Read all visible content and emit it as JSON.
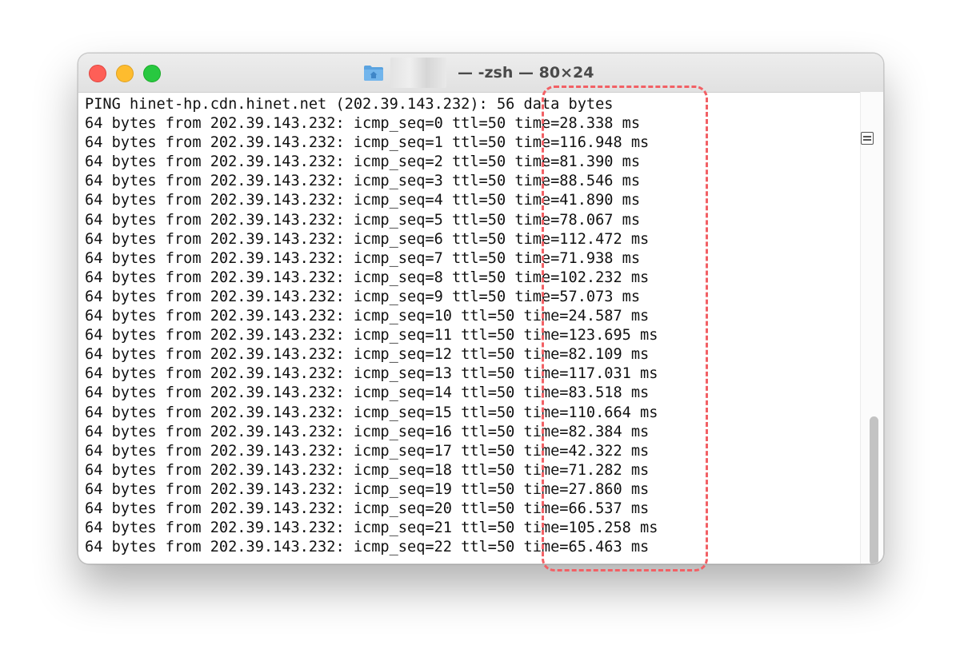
{
  "window": {
    "title": "— -zsh — 80×24",
    "folder_icon": "home-folder-icon"
  },
  "terminal": {
    "lines": [
      "PING hinet-hp.cdn.hinet.net (202.39.143.232): 56 data bytes",
      "64 bytes from 202.39.143.232: icmp_seq=0 ttl=50 time=28.338 ms",
      "64 bytes from 202.39.143.232: icmp_seq=1 ttl=50 time=116.948 ms",
      "64 bytes from 202.39.143.232: icmp_seq=2 ttl=50 time=81.390 ms",
      "64 bytes from 202.39.143.232: icmp_seq=3 ttl=50 time=88.546 ms",
      "64 bytes from 202.39.143.232: icmp_seq=4 ttl=50 time=41.890 ms",
      "64 bytes from 202.39.143.232: icmp_seq=5 ttl=50 time=78.067 ms",
      "64 bytes from 202.39.143.232: icmp_seq=6 ttl=50 time=112.472 ms",
      "64 bytes from 202.39.143.232: icmp_seq=7 ttl=50 time=71.938 ms",
      "64 bytes from 202.39.143.232: icmp_seq=8 ttl=50 time=102.232 ms",
      "64 bytes from 202.39.143.232: icmp_seq=9 ttl=50 time=57.073 ms",
      "64 bytes from 202.39.143.232: icmp_seq=10 ttl=50 time=24.587 ms",
      "64 bytes from 202.39.143.232: icmp_seq=11 ttl=50 time=123.695 ms",
      "64 bytes from 202.39.143.232: icmp_seq=12 ttl=50 time=82.109 ms",
      "64 bytes from 202.39.143.232: icmp_seq=13 ttl=50 time=117.031 ms",
      "64 bytes from 202.39.143.232: icmp_seq=14 ttl=50 time=83.518 ms",
      "64 bytes from 202.39.143.232: icmp_seq=15 ttl=50 time=110.664 ms",
      "64 bytes from 202.39.143.232: icmp_seq=16 ttl=50 time=82.384 ms",
      "64 bytes from 202.39.143.232: icmp_seq=17 ttl=50 time=42.322 ms",
      "64 bytes from 202.39.143.232: icmp_seq=18 ttl=50 time=71.282 ms",
      "64 bytes from 202.39.143.232: icmp_seq=19 ttl=50 time=27.860 ms",
      "64 bytes from 202.39.143.232: icmp_seq=20 ttl=50 time=66.537 ms",
      "64 bytes from 202.39.143.232: icmp_seq=21 ttl=50 time=105.258 ms",
      "64 bytes from 202.39.143.232: icmp_seq=22 ttl=50 time=65.463 ms"
    ]
  },
  "annotation": {
    "color": "#f26065"
  },
  "colors": {
    "close": "#fe5f57",
    "minimize": "#febc2e",
    "zoom": "#28c840"
  }
}
